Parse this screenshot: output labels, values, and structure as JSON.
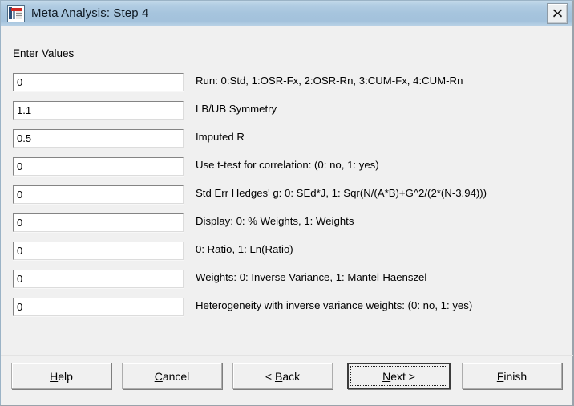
{
  "window": {
    "title": "Meta Analysis: Step 4",
    "icon": "chart-document-icon",
    "close_label": "✕",
    "accent_title_bar": "#a6c4dd",
    "background": "#f0f0f0"
  },
  "form": {
    "section_label": "Enter Values",
    "rows": [
      {
        "value": "0",
        "label": "Run: 0:Std, 1:OSR-Fx, 2:OSR-Rn, 3:CUM-Fx, 4:CUM-Rn"
      },
      {
        "value": "1.1",
        "label": "LB/UB Symmetry"
      },
      {
        "value": "0.5",
        "label": "Imputed R"
      },
      {
        "value": "0",
        "label": "Use t-test for correlation: (0: no, 1: yes)"
      },
      {
        "value": "0",
        "label": "Std Err Hedges' g: 0: SEd*J, 1: Sqr(N/(A*B)+G^2/(2*(N-3.94)))"
      },
      {
        "value": "0",
        "label": "Display: 0: % Weights, 1: Weights"
      },
      {
        "value": "0",
        "label": "0: Ratio, 1: Ln(Ratio)"
      },
      {
        "value": "0",
        "label": "Weights: 0: Inverse Variance, 1: Mantel-Haenszel"
      },
      {
        "value": "0",
        "label": "Heterogeneity with inverse variance weights: (0: no, 1: yes)"
      }
    ]
  },
  "buttons": {
    "help": {
      "before": "",
      "accel": "H",
      "after": "elp"
    },
    "cancel": {
      "before": "",
      "accel": "C",
      "after": "ancel"
    },
    "back": {
      "before": "< ",
      "accel": "B",
      "after": "ack"
    },
    "next": {
      "before": "",
      "accel": "N",
      "after": "ext >"
    },
    "finish": {
      "before": "",
      "accel": "F",
      "after": "inish"
    }
  }
}
